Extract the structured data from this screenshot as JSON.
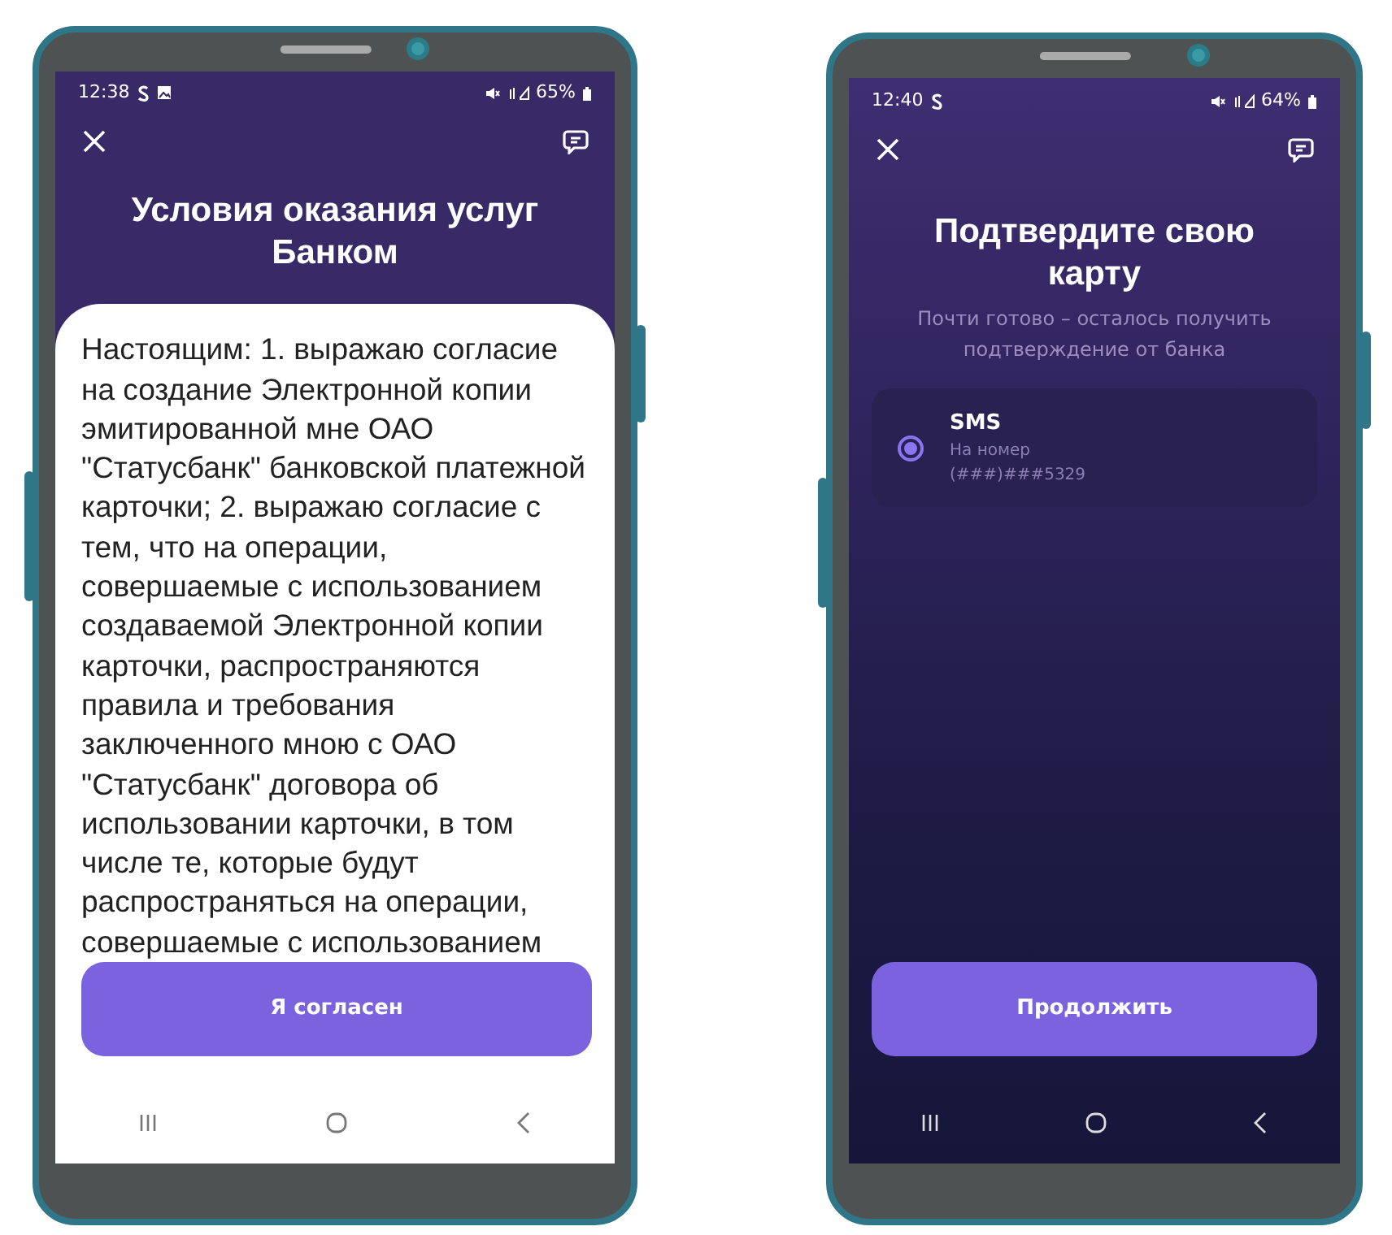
{
  "phones": [
    {
      "kind": "terms",
      "status_bar": {
        "time": "12:38",
        "notifications": [
          {
            "kind": "s"
          },
          {
            "kind": "image"
          }
        ],
        "battery": "65%"
      },
      "title": "Условия оказания услуг Банком",
      "terms_text": "Настоящим: 1. выражаю согласие на создание Электронной копии эмитированной мне ОАО \"Статусбанк\" банковской платежной карточки; 2. выражаю согласие с тем, что на операции, совершаемые с использованием создаваемой Электронной копии карточки, распространяются правила и требования заключенного мною с ОАО \"Статусбанк\" договора об использовании карточки, в том числе те, которые будут распространяться на операции, совершаемые с использованием",
      "button": "Я согласен"
    },
    {
      "kind": "confirm",
      "status_bar": {
        "time": "12:40",
        "notifications": [
          {
            "kind": "s"
          }
        ],
        "battery": "64%"
      },
      "title": "Подтвердите свою карту",
      "subtitle": "Почти готово – осталось получить подтверждение от банка",
      "options": [
        {
          "title": "SMS",
          "label": "На номер",
          "value": "(###)###5329",
          "selected": true
        }
      ],
      "button": "Продолжить"
    }
  ]
}
